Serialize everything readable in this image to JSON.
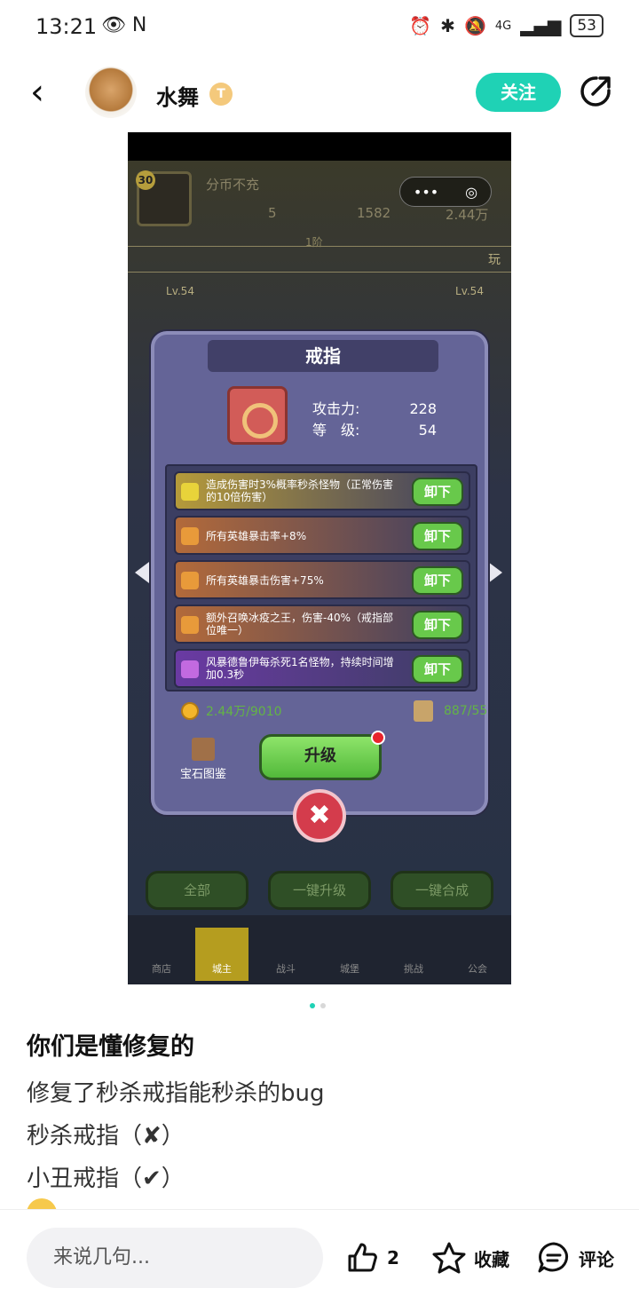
{
  "status_bar": {
    "time": "13:21",
    "icons_left": "👁 N",
    "battery": "53",
    "network": "4G"
  },
  "header": {
    "back_icon": "‹",
    "username": "水舞",
    "badge": "T",
    "follow_label": "关注"
  },
  "screenshot": {
    "hud": {
      "level": "30",
      "name": "分币不充",
      "value1": "5",
      "value2": "1582",
      "value3": "2.44万",
      "capsule_more": "•••",
      "capsule_target": "◎"
    },
    "level_line": {
      "center": "1阶",
      "right": "玩"
    },
    "side_levels": {
      "left": "Lv.54",
      "right": "Lv.54"
    },
    "dialog": {
      "title": "戒指",
      "attack_label": "攻击力:",
      "attack_value": "228",
      "level_label": "等　级:",
      "level_value": "54",
      "gems": [
        {
          "text": "造成伤害时3%概率秒杀怪物（正常伤害的10倍伤害）",
          "button": "卸下",
          "color": "#b59a3a",
          "icon": "#e8d33a"
        },
        {
          "text": "所有英雄暴击率+8%",
          "button": "卸下",
          "color": "#b36a3a",
          "icon": "#e89a3a"
        },
        {
          "text": "所有英雄暴击伤害+75%",
          "button": "卸下",
          "color": "#b36a3a",
          "icon": "#e89a3a"
        },
        {
          "text": "额外召唤冰疫之王，伤害-40%（戒指部位唯一）",
          "button": "卸下",
          "color": "#b36a3a",
          "icon": "#e89a3a"
        },
        {
          "text": "风暴德鲁伊每杀死1名怪物，持续时间增加0.3秒",
          "button": "卸下",
          "color": "#6a3aa3",
          "icon": "#c26ae0"
        }
      ],
      "coin_text": "2.44万/9010",
      "scroll_text": "887/55",
      "book_label": "宝石图鉴",
      "upgrade_label": "升级",
      "close_icon": "✖"
    },
    "game_buttons": [
      "全部",
      "一键升级",
      "一键合成"
    ],
    "game_nav": [
      "商店",
      "城主",
      "战斗",
      "城堡",
      "挑战",
      "公会"
    ]
  },
  "post": {
    "title": "你们是懂修复的",
    "lines": [
      "修复了秒杀戒指能秒杀的bug",
      "秒杀戒指（✘）",
      "小丑戒指（✔）"
    ]
  },
  "bottom_bar": {
    "input_placeholder": "来说几句...",
    "like_count": "2",
    "favorite_label": "收藏",
    "comment_label": "评论"
  }
}
